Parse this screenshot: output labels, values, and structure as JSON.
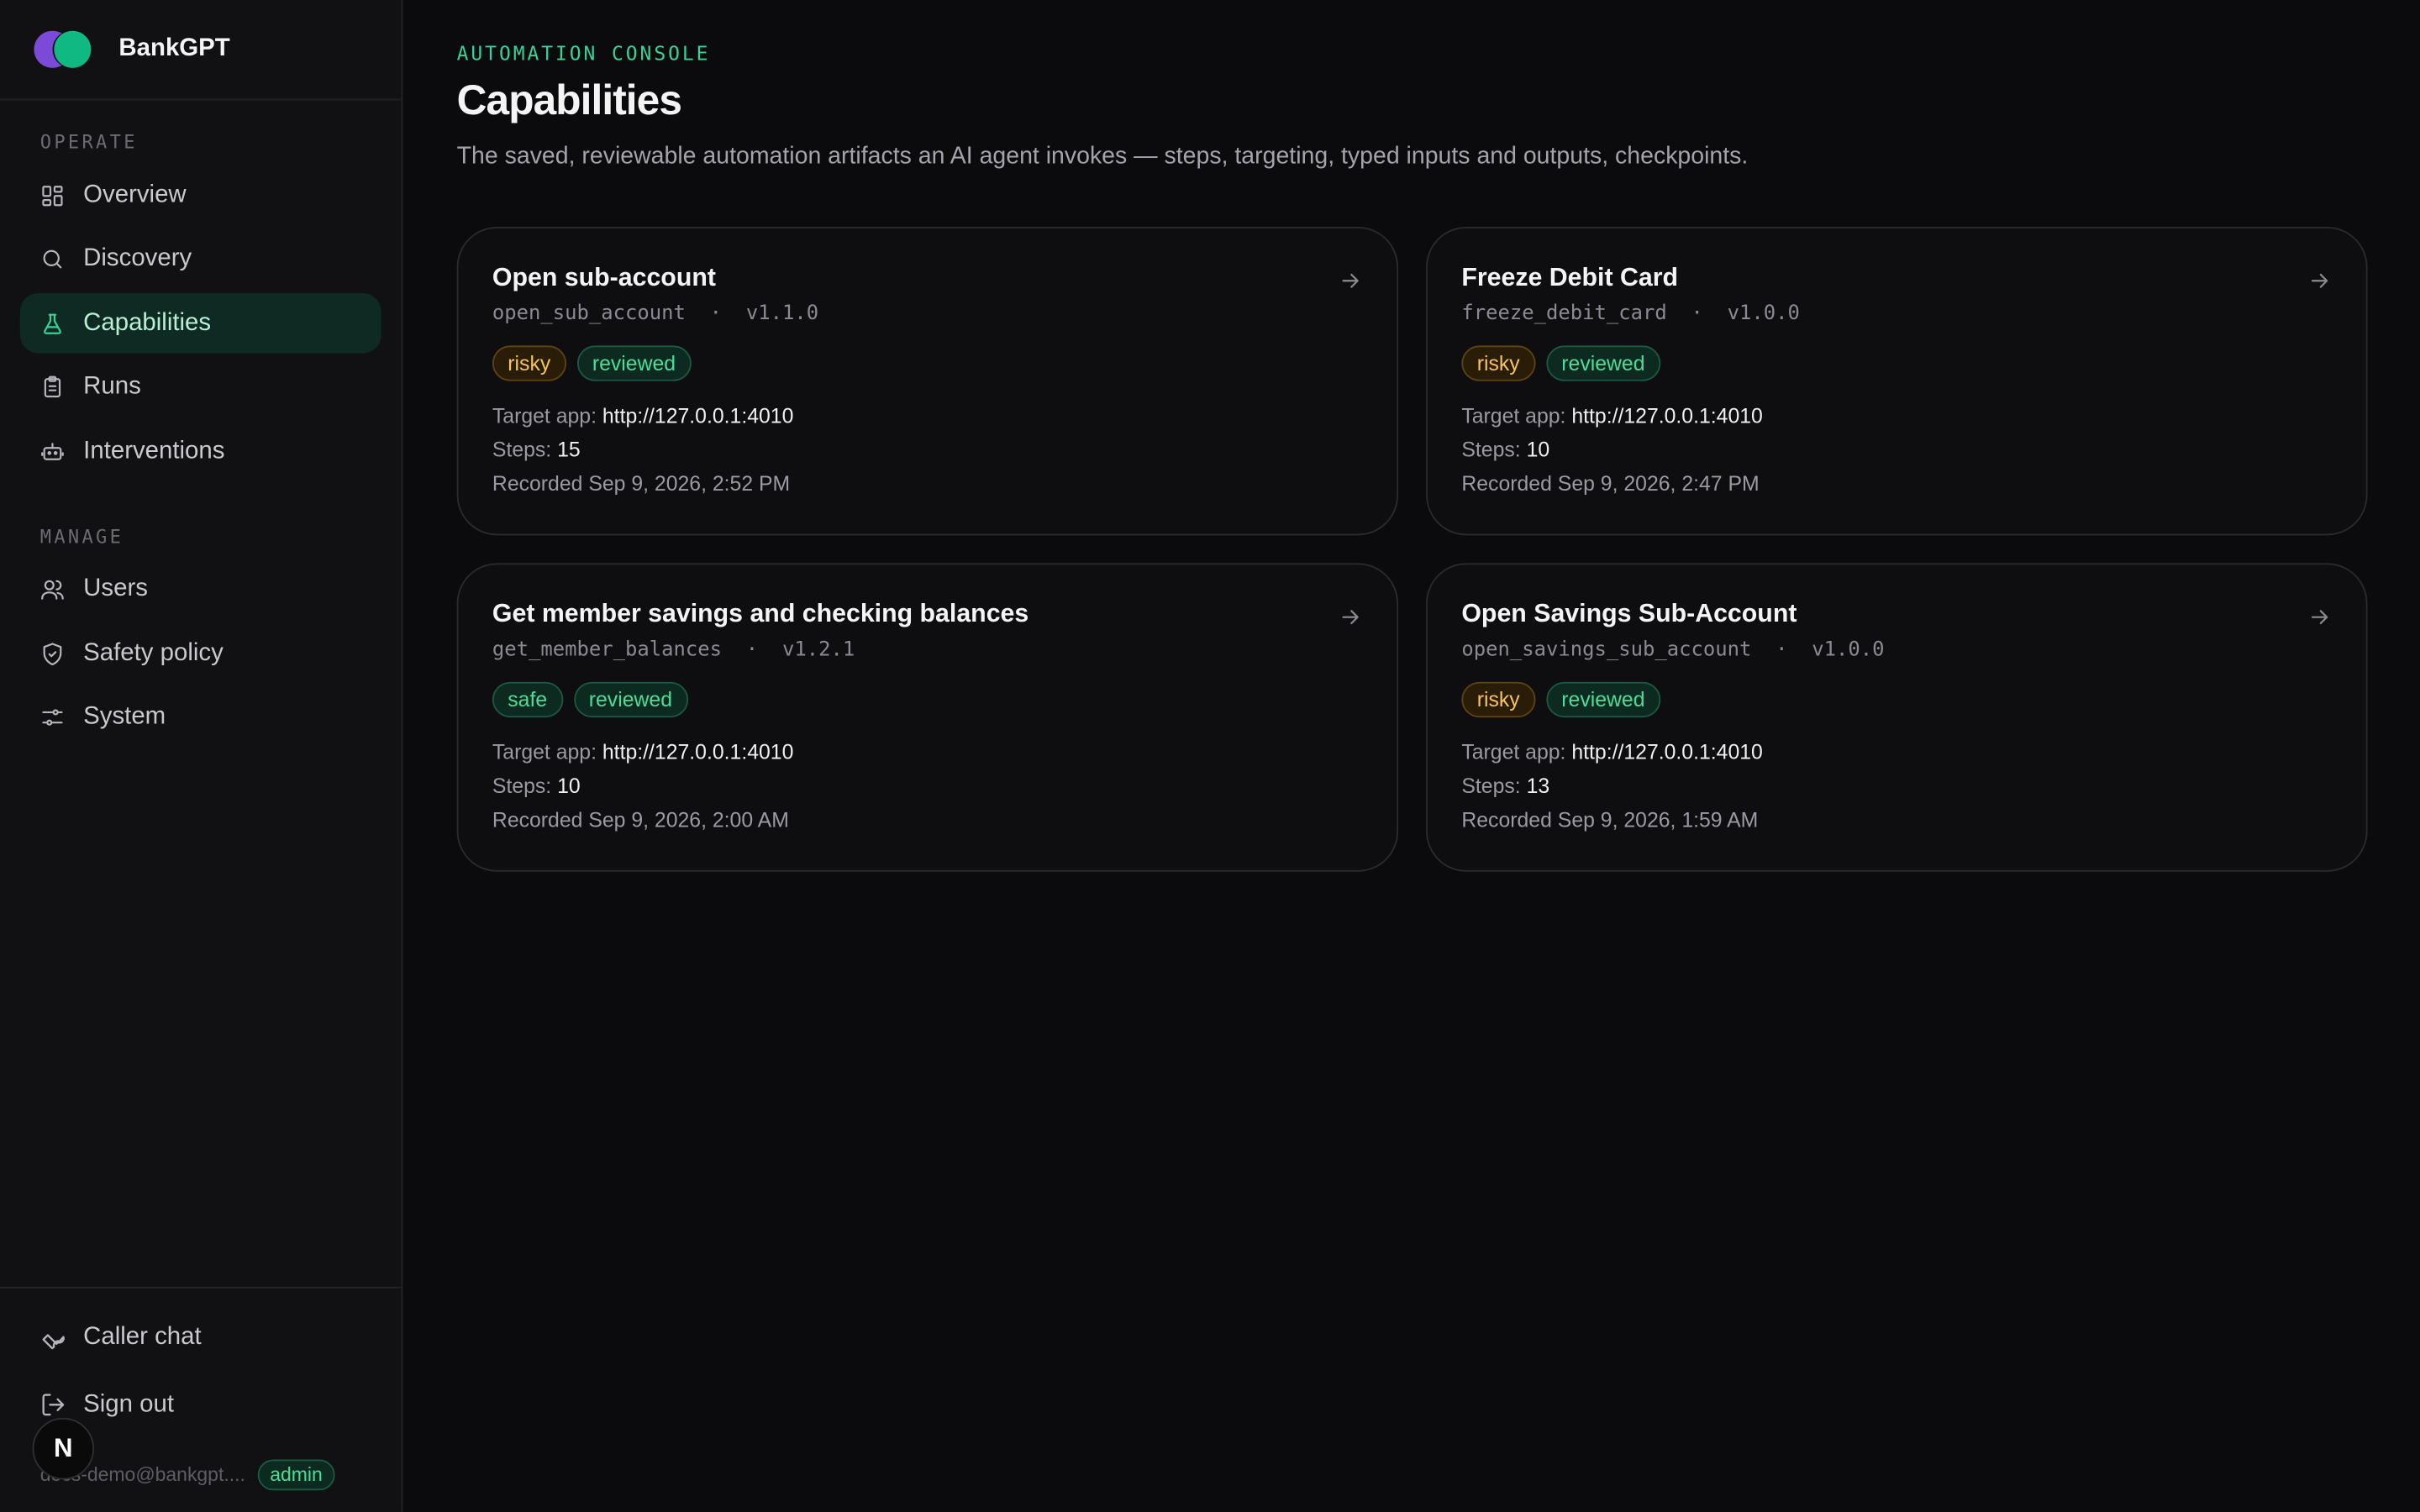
{
  "brand": {
    "name": "BankGPT"
  },
  "sidebar": {
    "operate_label": "OPERATE",
    "operate": [
      {
        "label": "Overview",
        "icon": "grid-icon"
      },
      {
        "label": "Discovery",
        "icon": "search-icon"
      },
      {
        "label": "Capabilities",
        "icon": "flask-icon",
        "active": true
      },
      {
        "label": "Runs",
        "icon": "clipboard-icon"
      },
      {
        "label": "Interventions",
        "icon": "robot-icon"
      }
    ],
    "manage_label": "MANAGE",
    "manage": [
      {
        "label": "Users",
        "icon": "users-icon"
      },
      {
        "label": "Safety policy",
        "icon": "shield-icon"
      },
      {
        "label": "System",
        "icon": "sliders-icon"
      }
    ],
    "bottom": [
      {
        "label": "Caller chat",
        "icon": "wrench-icon"
      },
      {
        "label": "Sign out",
        "icon": "logout-icon"
      }
    ],
    "user": {
      "email": "docs-demo@bankgpt....",
      "role": "admin"
    },
    "dev_badge": "N"
  },
  "header": {
    "eyebrow": "AUTOMATION CONSOLE",
    "title": "Capabilities",
    "subtitle": "The saved, reviewable automation artifacts an AI agent invokes — steps, targeting, typed inputs and outputs, checkpoints."
  },
  "meta_labels": {
    "target": "Target app:",
    "steps": "Steps:",
    "recorded": "Recorded"
  },
  "cards": [
    {
      "title": "Open sub-account",
      "slug": "open_sub_account",
      "version": "v1.1.0",
      "risk": "risky",
      "status": "reviewed",
      "target": "http://127.0.0.1:4010",
      "steps": "15",
      "recorded": "Sep 9, 2026, 2:52 PM"
    },
    {
      "title": "Freeze Debit Card",
      "slug": "freeze_debit_card",
      "version": "v1.0.0",
      "risk": "risky",
      "status": "reviewed",
      "target": "http://127.0.0.1:4010",
      "steps": "10",
      "recorded": "Sep 9, 2026, 2:47 PM"
    },
    {
      "title": "Get member savings and checking balances",
      "slug": "get_member_balances",
      "version": "v1.2.1",
      "risk": "safe",
      "status": "reviewed",
      "target": "http://127.0.0.1:4010",
      "steps": "10",
      "recorded": "Sep 9, 2026, 2:00 AM"
    },
    {
      "title": "Open Savings Sub-Account",
      "slug": "open_savings_sub_account",
      "version": "v1.0.0",
      "risk": "risky",
      "status": "reviewed",
      "target": "http://127.0.0.1:4010",
      "steps": "13",
      "recorded": "Sep 9, 2026, 1:59 AM"
    }
  ]
}
